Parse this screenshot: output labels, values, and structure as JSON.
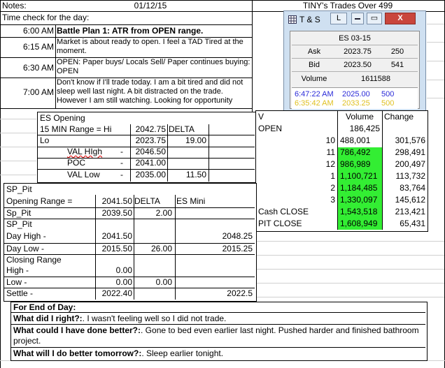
{
  "header": {
    "notes_label": "Notes:",
    "date": "01/12/15",
    "tiny_title": "TINY's Trades Over 499"
  },
  "time_check": "Time check for the day:",
  "journal": [
    {
      "time": "6:00 AM",
      "text": "Battle Plan 1:  ATR from OPEN range."
    },
    {
      "time": "6:15 AM",
      "text": "Market is about ready to open.  I feel a TAD Tired at the moment."
    },
    {
      "time": "6:30 AM",
      "text": "OPEN: Paper buys/ Locals Sell/ Paper continues buying: OPEN"
    },
    {
      "time": "7:00 AM",
      "text": "Don't know if I'll trade today.  I am a bit tired and did not sleep well last night.  A bit distracted on the trade.  However I am still watching.  Looking for opportunity"
    }
  ],
  "ts_window": {
    "title": "T & S",
    "btn_l": "L",
    "btn_restore": "▭",
    "btn_close": "X",
    "symbol": "ES 03-15",
    "ask_label": "Ask",
    "ask_price": "2023.75",
    "ask_size": "250",
    "bid_label": "Bid",
    "bid_price": "2023.50",
    "bid_size": "541",
    "volume_label": "Volume",
    "volume": "1611588",
    "trades": [
      {
        "time": "6:47:22 AM",
        "price": "2025.00",
        "size": "500"
      },
      {
        "time": "6:35:42 AM",
        "price": "2033.25",
        "size": "500"
      }
    ]
  },
  "es_opening": {
    "title": "ES Opening",
    "range_label": "15 MIN Range = Hi",
    "hi": "2042.75",
    "delta_label": "DELTA",
    "lo_label": "Lo",
    "lo": "2023.75",
    "delta": "19.00",
    "val_high_label": "VAL HIgh",
    "val_high_dash": "-",
    "val_high": "2046.50",
    "poc_label": "POC",
    "poc_dash": "-",
    "poc": "2041.00",
    "val_low_label": "VAL Low",
    "val_low_dash": "-",
    "val_low": "2035.00",
    "val_delta": "11.50"
  },
  "volume_table": {
    "col_v": "V",
    "col_volume": "Volume",
    "col_change": "Change",
    "open_label": "OPEN",
    "open_volume": "186,425",
    "rows": [
      {
        "label": "10",
        "volume": "488,001",
        "change": "301,576",
        "hl": false
      },
      {
        "label": "11",
        "volume": "786,492",
        "change": "298,491",
        "hl": true
      },
      {
        "label": "12",
        "volume": "986,989",
        "change": "200,497",
        "hl": true
      },
      {
        "label": "1",
        "volume": "1,100,721",
        "change": "113,732",
        "hl": true
      },
      {
        "label": "2",
        "volume": "1,184,485",
        "change": "83,764",
        "hl": true
      },
      {
        "label": "3",
        "volume": "1,330,097",
        "change": "145,612",
        "hl": true
      }
    ],
    "cash_close_label": "Cash CLOSE",
    "cash_close_volume": "1,543,518",
    "cash_close_change": "213,421",
    "pit_close_label": "PIT CLOSE",
    "pit_close_volume": "1,608,949",
    "pit_close_change": "65,431"
  },
  "sp_pit": {
    "title1": "SP_Pit",
    "opening_range_label": "Opening Range =",
    "opening_range": "2041.50",
    "delta_label": "DELTA",
    "es_mini_label": "ES Mini",
    "sp_pit_label": "Sp_Pit",
    "sp_pit_value": "2039.50",
    "sp_pit_delta": "2.00",
    "title2": "SP_Pit",
    "day_high_label": "Day High -",
    "day_high": "2041.50",
    "day_high_es": "2048.25",
    "day_low_label": "Day Low -",
    "day_low": "2015.50",
    "day_low_delta": "26.00",
    "day_low_es": "2015.25",
    "closing_range_label": "Closing Range",
    "high_label": "High -",
    "high_value": "0.00",
    "low_label": "Low -",
    "low_value": "0.00",
    "low_delta": "0.00",
    "settle_label": "Settle -",
    "settle_value": "2022.40",
    "settle_es": "2022.5"
  },
  "end_of_day": {
    "title": "For End of Day:",
    "q1": "What did I right?:",
    "a1": ". I wasn't feeling well so I did not trade.",
    "q2": "What could I have done better?:",
    "a2": ". Gone to bed even earlier last night.  Pushed harder and finished bathroom project.",
    "q3": "What will I do better tomorrow?:",
    "a3": ". Sleep earlier tonight."
  }
}
